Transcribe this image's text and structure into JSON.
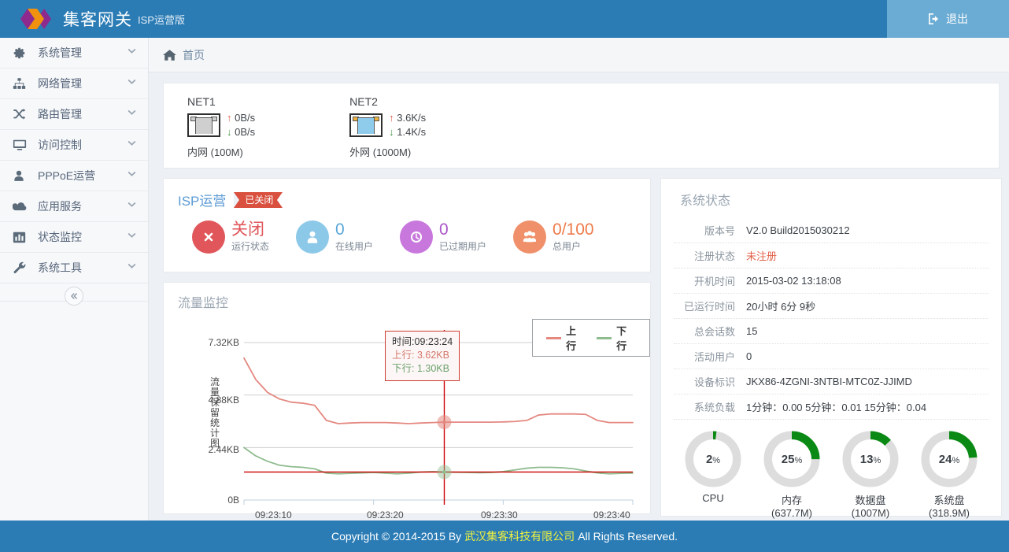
{
  "header": {
    "brand_title": "集客网关",
    "brand_sub": "ISP运营版",
    "logo_icon": "double-diamond-logo",
    "logout_label": "退出",
    "logout_icon": "sign-out-icon",
    "bar_color": "#2b7cb5"
  },
  "sidebar": {
    "items": [
      {
        "label": "系统管理",
        "icon": "gear-icon",
        "chevron": "chevron-down-icon"
      },
      {
        "label": "网络管理",
        "icon": "sitemap-icon",
        "chevron": "chevron-down-icon"
      },
      {
        "label": "路由管理",
        "icon": "random-arrows-icon",
        "chevron": "chevron-down-icon"
      },
      {
        "label": "访问控制",
        "icon": "desktop-icon",
        "chevron": "chevron-down-icon"
      },
      {
        "label": "PPPoE运营",
        "icon": "user-icon",
        "chevron": "chevron-down-icon"
      },
      {
        "label": "应用服务",
        "icon": "cloud-icon",
        "chevron": "chevron-down-icon"
      },
      {
        "label": "状态监控",
        "icon": "bar-chart-icon",
        "chevron": "chevron-down-icon"
      },
      {
        "label": "系统工具",
        "icon": "wrench-icon",
        "chevron": "chevron-down-icon"
      }
    ],
    "collapse_icon": "double-chevron-left-icon"
  },
  "breadcrumb": {
    "home_icon": "home-icon",
    "label": "首页"
  },
  "net_panel": {
    "ports": [
      {
        "name": "NET1",
        "state": "gray",
        "up": "0B/s",
        "down": "0B/s",
        "footer": "内网 (100M)"
      },
      {
        "name": "NET2",
        "state": "blue",
        "up": "3.6K/s",
        "down": "1.4K/s",
        "footer": "外网 (1000M)"
      }
    ],
    "up_arrow": "arrow-up-icon",
    "down_arrow": "arrow-down-icon"
  },
  "isp_panel": {
    "title": "ISP运营",
    "ribbon_label": "已关闭",
    "ribbon_color": "#d9503f",
    "stats": [
      {
        "icon": "times-circle-icon",
        "color": "#e0565a",
        "value": "关闭",
        "value_color": "#e0565a",
        "label": "运行状态"
      },
      {
        "icon": "user-circle-icon",
        "color": "#8cc8e8",
        "value": "0",
        "value_color": "#5aa7d8",
        "label": "在线用户"
      },
      {
        "icon": "clock-circle-icon",
        "color": "#c878dc",
        "value": "0",
        "value_color": "#a955c8",
        "label": "已过期用户"
      },
      {
        "icon": "users-circle-icon",
        "color": "#f0906a",
        "value": "0/100",
        "value_color": "#ee7b4a",
        "label": "总用户"
      }
    ]
  },
  "system_status": {
    "title": "系统状态",
    "rows": [
      {
        "key": "版本号",
        "value": "V2.0 Build2015030212",
        "warn": false
      },
      {
        "key": "注册状态",
        "value": "未注册",
        "warn": true
      },
      {
        "key": "开机时间",
        "value": "2015-03-02 13:18:08",
        "warn": false
      },
      {
        "key": "已运行时间",
        "value": "20小时 6分 9秒",
        "warn": false
      },
      {
        "key": "总会话数",
        "value": "15",
        "warn": false
      },
      {
        "key": "活动用户",
        "value": "0",
        "warn": false
      },
      {
        "key": "设备标识",
        "value": "JKX86-4ZGNI-3NTBI-MTC0Z-JJIMD",
        "warn": false
      },
      {
        "key": "系统负载",
        "value": "1分钟：0.00  5分钟：0.01  15分钟：0.04",
        "warn": false
      }
    ],
    "gauges": [
      {
        "percent": 2,
        "pct_label": "2",
        "unit": "%",
        "name": "CPU",
        "sub": ""
      },
      {
        "percent": 25,
        "pct_label": "25",
        "unit": "%",
        "name": "内存",
        "sub": "(637.7M)"
      },
      {
        "percent": 13,
        "pct_label": "13",
        "unit": "%",
        "name": "数据盘",
        "sub": "(1007M)"
      },
      {
        "percent": 24,
        "pct_label": "24",
        "unit": "%",
        "name": "系统盘",
        "sub": "(318.9M)"
      }
    ],
    "gauge_fill_color": "#0a8a14",
    "gauge_track_color": "#dddddd"
  },
  "chart_panel": {
    "title": "流量监控",
    "ylabel": "流量保留统计图",
    "tooltip": {
      "time_key": "时间",
      "time_value": "09:23:24",
      "up_key": "上行",
      "up_value": "3.62KB",
      "down_key": "下行",
      "down_value": "1.30KB"
    },
    "legend": [
      {
        "label": "上行",
        "color": "#e48880"
      },
      {
        "label": "下行",
        "color": "#8fbc8f"
      }
    ]
  },
  "chart_data": {
    "type": "line",
    "title": "流量监控",
    "xlabel": "",
    "ylabel": "流量保留统计图",
    "grid": true,
    "legend_position": "top-right",
    "x_tick_labels": [
      "09:23:10",
      "09:23:20",
      "09:23:30",
      "09:23:40"
    ],
    "y_tick_labels": [
      "0B",
      "2.44KB",
      "4.88KB",
      "7.32KB"
    ],
    "y_tick_values": [
      0,
      2.44,
      4.88,
      7.32
    ],
    "ylim": [
      0,
      7.32
    ],
    "y_unit": "KB",
    "cursor": {
      "time": "09:23:24",
      "up": 3.62,
      "down": 1.3
    },
    "series": [
      {
        "name": "上行",
        "color": "#e48880",
        "values": [
          6.6,
          5.6,
          5.0,
          4.7,
          4.55,
          4.5,
          4.4,
          3.7,
          3.55,
          3.58,
          3.6,
          3.6,
          3.6,
          3.58,
          3.55,
          3.58,
          3.6,
          3.62,
          3.62,
          3.62,
          3.62,
          3.62,
          3.63,
          3.65,
          3.7,
          3.95,
          4.0,
          4.0,
          4.0,
          3.98,
          3.7,
          3.6,
          3.6,
          3.6
        ]
      },
      {
        "name": "下行",
        "color": "#8fbc8f",
        "values": [
          2.44,
          2.05,
          1.8,
          1.62,
          1.55,
          1.52,
          1.45,
          1.25,
          1.22,
          1.24,
          1.26,
          1.28,
          1.25,
          1.22,
          1.25,
          1.3,
          1.32,
          1.3,
          1.29,
          1.28,
          1.27,
          1.28,
          1.32,
          1.4,
          1.48,
          1.52,
          1.52,
          1.5,
          1.45,
          1.35,
          1.26,
          1.22,
          1.24,
          1.25
        ]
      }
    ]
  },
  "footer": {
    "prefix": "Copyright © 2014-2015 By",
    "company": "武汉集客科技有限公司",
    "suffix": "All Rights Reserved."
  }
}
